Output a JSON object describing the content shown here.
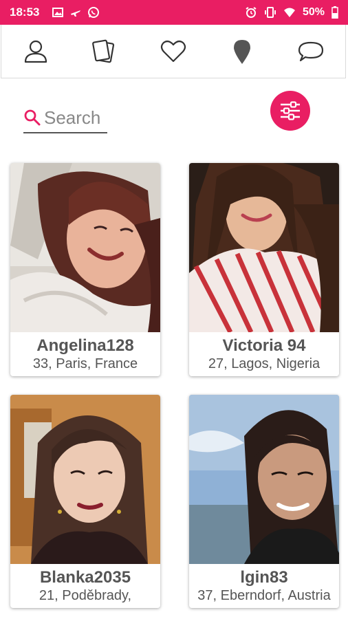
{
  "status": {
    "time": "18:53",
    "battery": "50%",
    "colors": {
      "bar": "#e91e63"
    }
  },
  "nav": {
    "icons": [
      "profile-icon",
      "cards-icon",
      "heart-icon",
      "location-pin-icon",
      "chat-bubble-icon"
    ]
  },
  "search": {
    "placeholder": "Search",
    "value": ""
  },
  "filter": {
    "icon": "sliders-icon",
    "color": "#e91e63"
  },
  "profiles": [
    {
      "name": "Angelina128",
      "details": "33, Paris, France"
    },
    {
      "name": "Victoria 94",
      "details": "27, Lagos, Nigeria"
    },
    {
      "name": "Blanka2035",
      "details": "21, Poděbrady,"
    },
    {
      "name": "lgin83",
      "details": "37, Eberndorf, Austria"
    }
  ]
}
